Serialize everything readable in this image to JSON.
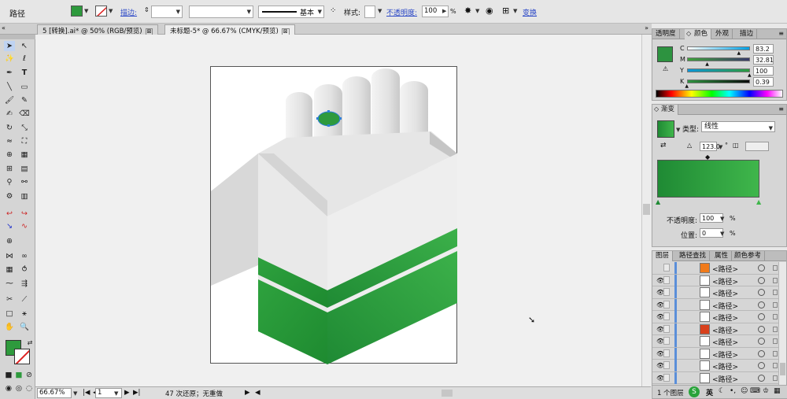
{
  "control": {
    "label": "路径",
    "stroke_link": "描边:",
    "stroke_style": "基本",
    "style_label": "样式:",
    "opacity_link": "不透明度:",
    "opacity_value": "100",
    "opacity_unit": "%",
    "transform_link": "变换"
  },
  "tabs": [
    {
      "label": "5 [转换].ai* @ 50% (RGB/预览)",
      "close": "⊠"
    },
    {
      "label": "未标题-5* @ 66.67% (CMYK/预览)",
      "close": "⊠"
    }
  ],
  "status": {
    "zoom": "66.67%",
    "page": "1",
    "undo_text": "47 次还原；无重做"
  },
  "color_panel": {
    "tabs": [
      "透明度",
      "颜色",
      "外观",
      "描边"
    ],
    "active_tab": "颜色",
    "channels": [
      {
        "name": "C",
        "value": "83.2",
        "level": 0.832
      },
      {
        "name": "M",
        "value": "32.81",
        "level": 0.328
      },
      {
        "name": "Y",
        "value": "100",
        "level": 1.0
      },
      {
        "name": "K",
        "value": "0.39",
        "level": 0.004
      }
    ],
    "swatch_color": "#2d9340"
  },
  "gradient_panel": {
    "title": "渐变",
    "type_label": "类型:",
    "type_value": "线性",
    "angle_value": "123.0",
    "angle_unit": "°",
    "opacity_label": "不透明度:",
    "opacity_value": "100",
    "opacity_unit": "%",
    "position_label": "位置:",
    "position_value": "0",
    "position_unit": "%",
    "start_color": "#1f8a34",
    "end_color": "#3fb64b"
  },
  "layers_panel": {
    "tabs": [
      "图层",
      "路径查找",
      "属性",
      "颜色参考"
    ],
    "active_tab": "图层",
    "rows": [
      {
        "name": "<路径>",
        "thumb_color": "#f07a1a"
      },
      {
        "name": "<路径>",
        "thumb_color": "#ffffff"
      },
      {
        "name": "<路径>",
        "thumb_color": "#ffffff"
      },
      {
        "name": "<路径>",
        "thumb_color": "#ffffff"
      },
      {
        "name": "<路径>",
        "thumb_color": "#ffffff"
      },
      {
        "name": "<路径>",
        "thumb_color": "#d8401c"
      },
      {
        "name": "<路径>",
        "thumb_color": "#ffffff"
      },
      {
        "name": "<路径>",
        "thumb_color": "#ffffff"
      },
      {
        "name": "<路径>",
        "thumb_color": "#ffffff"
      },
      {
        "name": "<路径>",
        "thumb_color": "#ffffff"
      }
    ],
    "footer": "1 个图层",
    "ime_label": "英"
  },
  "colors": {
    "green": "#2e9a3d",
    "green_dark": "#1f7f2f",
    "grey_light": "#ececec",
    "grey_mid": "#d9d9d9",
    "grey_dark": "#c4c4c4",
    "selection": "#2d7fd8"
  }
}
